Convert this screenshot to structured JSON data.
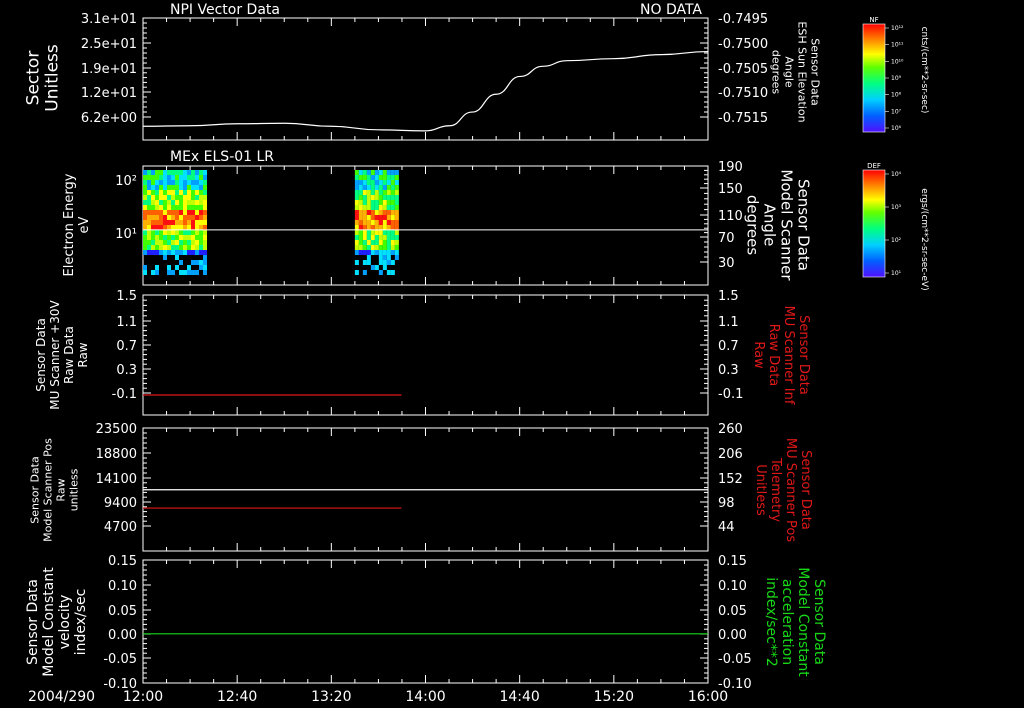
{
  "colors": {
    "background": "#000000",
    "axes": "#ffffff",
    "red_series": "#e01818",
    "green_series": "#18d818",
    "white_series": "#ffffff"
  },
  "time_axis": {
    "date_label": "2004/290",
    "ticks": [
      "12:00",
      "12:40",
      "13:20",
      "14:00",
      "14:40",
      "15:20",
      "16:00"
    ]
  },
  "chart_data": [
    {
      "type": "line",
      "title": "NPI Vector Data",
      "status": "NO DATA",
      "ylabel_left": [
        "Sector",
        "Unitless"
      ],
      "ylabel_right": [
        "Sensor Data",
        "ESH Sun Elevation",
        "Angle",
        "degrees"
      ],
      "left_ticks": [
        "3.1e+01",
        "2.5e+01",
        "1.9e+01",
        "1.2e+01",
        "6.2e+00"
      ],
      "right_ticks": [
        "-0.7495",
        "-0.7500",
        "-0.7505",
        "-0.7510",
        "-0.7515"
      ],
      "ylim_right": [
        -0.7518,
        -0.7494
      ],
      "x_hours": [
        12.0,
        12.33,
        12.67,
        13.0,
        13.33,
        13.67,
        14.0,
        14.17,
        14.33,
        14.5,
        14.67,
        14.83,
        15.0,
        15.33,
        15.67,
        16.0
      ],
      "series": [
        {
          "color": "white",
          "values": [
            -0.75153,
            -0.75152,
            -0.75148,
            -0.75147,
            -0.75153,
            -0.7516,
            -0.75162,
            -0.75152,
            -0.75125,
            -0.7509,
            -0.75055,
            -0.75035,
            -0.75024,
            -0.7502,
            -0.75012,
            -0.75006
          ]
        }
      ]
    },
    {
      "type": "heatmap",
      "title": "MEx ELS-01 LR",
      "ylabel_left": [
        "Electron Energy",
        "eV"
      ],
      "ylabel_right": [
        "Sensor Data",
        "Model Scanner",
        "Angle",
        "degrees"
      ],
      "left_ticks": [
        "10²",
        "10¹"
      ],
      "right_ticks": [
        "190",
        "150",
        "110",
        "70",
        "30"
      ],
      "ylim_right": [
        0,
        190
      ],
      "scanner_angle_line": 88,
      "data_intervals_hours": [
        [
          12.0,
          12.43
        ],
        [
          13.5,
          13.8
        ]
      ]
    },
    {
      "type": "line",
      "ylabel_left": [
        "Sensor Data",
        "MU Scanner +30V",
        "Raw Data",
        "Raw"
      ],
      "ylabel_right": [
        "Sensor Data",
        "MU Scanner Inf",
        "Raw Data",
        "Raw"
      ],
      "left_ticks": [
        "1.5",
        "1.1",
        "0.7",
        "0.3",
        "-0.1"
      ],
      "right_ticks": [
        "1.5",
        "1.1",
        "0.7",
        "0.3",
        "-0.1"
      ],
      "ylim": [
        -0.3,
        1.5
      ],
      "series": [
        {
          "color": "red",
          "x_hours": [
            12.0,
            13.83
          ],
          "values": [
            0.0,
            0.0
          ]
        }
      ]
    },
    {
      "type": "line",
      "ylabel_left": [
        "Sensor Data",
        "Model Scanner Pos",
        "Raw",
        "unitless"
      ],
      "ylabel_right": [
        "Sensor Data",
        "MU Scanner Pos",
        "Telemetry",
        "Unitless"
      ],
      "left_ticks": [
        "23500",
        "18800",
        "14100",
        "9400",
        "4700"
      ],
      "right_ticks": [
        "260",
        "206",
        "152",
        "98",
        "44"
      ],
      "ylim_left": [
        0,
        23500
      ],
      "ylim_right": [
        0,
        260
      ],
      "series": [
        {
          "color": "white",
          "axis": "left",
          "x_hours": [
            12.0,
            16.0
          ],
          "values": [
            11700,
            11700
          ]
        },
        {
          "color": "red",
          "axis": "left",
          "x_hours": [
            12.0,
            13.83
          ],
          "values": [
            8200,
            8200
          ]
        }
      ]
    },
    {
      "type": "line",
      "ylabel_left": [
        "Sensor Data",
        "Model Constant",
        "velocity",
        "index/sec"
      ],
      "ylabel_right": [
        "Sensor Data",
        "Model Constant",
        "acceleration",
        "index/sec**2"
      ],
      "left_ticks": [
        "0.15",
        "0.10",
        "0.05",
        "0.00",
        "-0.05",
        "-0.10"
      ],
      "right_ticks": [
        "0.15",
        "0.10",
        "0.05",
        "0.00",
        "-0.05",
        "-0.10"
      ],
      "ylim": [
        -0.1,
        0.15
      ],
      "series": [
        {
          "color": "green",
          "x_hours": [
            12.0,
            16.0
          ],
          "values": [
            0.0,
            0.0
          ]
        }
      ]
    }
  ],
  "colorbars": [
    {
      "name": "NF",
      "label": "cnts/(cm**2-sr-sec)",
      "ticks": [
        "10¹²",
        "10¹¹",
        "10¹⁰",
        "10⁹",
        "10⁸",
        "10⁷",
        "10⁶"
      ]
    },
    {
      "name": "DEF",
      "label": "ergs/(cm**2-sr-sec-eV)",
      "ticks": [
        "10⁴",
        "10³",
        "10²",
        "10¹"
      ]
    }
  ]
}
